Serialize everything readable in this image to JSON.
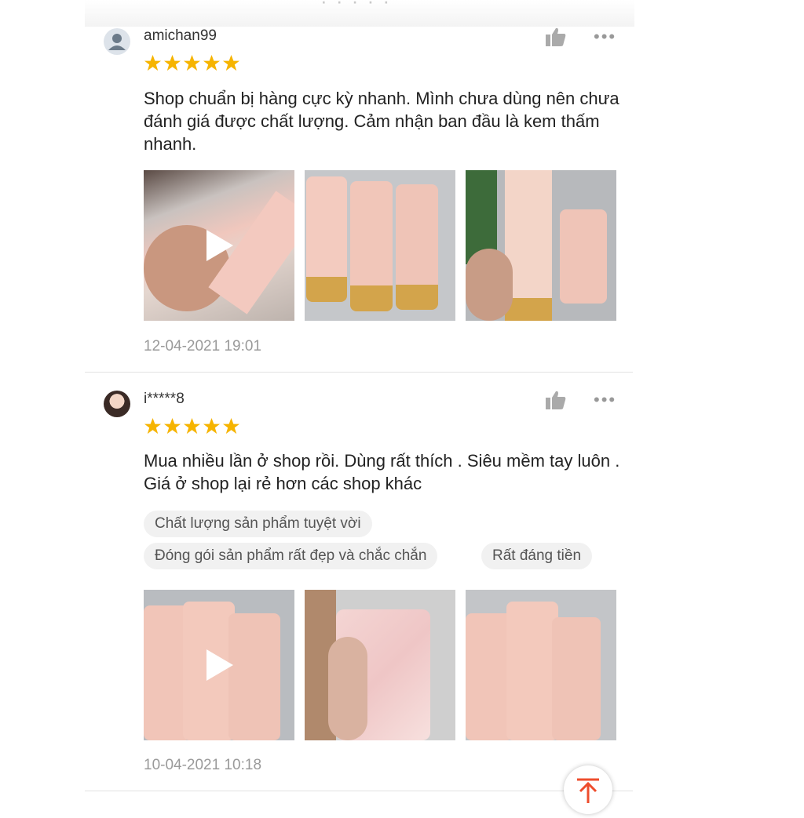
{
  "reviews": [
    {
      "username": "amichan99",
      "rating": 5,
      "comment": "Shop chuẩn bị hàng cực kỳ nhanh. Mình chưa dùng nên chưa đánh giá được chất lượng. Cảm nhận ban đầu là kem thấm nhanh.",
      "date": "12-04-2021 19:01",
      "more_label": "•••"
    },
    {
      "username": "i*****8",
      "rating": 5,
      "comment": "Mua nhiều lần ở shop rồi. Dùng rất thích . Siêu mềm tay luôn . Giá ở shop lại rẻ hơn các shop khác",
      "tags": [
        "Chất lượng sản phẩm tuyệt vời",
        "Đóng gói sản phẩm rất đẹp và chắc chắn",
        "Rất đáng tiền"
      ],
      "date": "10-04-2021 10:18",
      "more_label": "•••"
    }
  ],
  "colors": {
    "star": "#f6b400",
    "accent": "#ee4d2d",
    "muted": "#9a9a9a"
  },
  "icons": [
    "user-icon",
    "thumbs-up-icon",
    "more-icon",
    "star-icon",
    "play-icon",
    "arrow-up-icon"
  ]
}
